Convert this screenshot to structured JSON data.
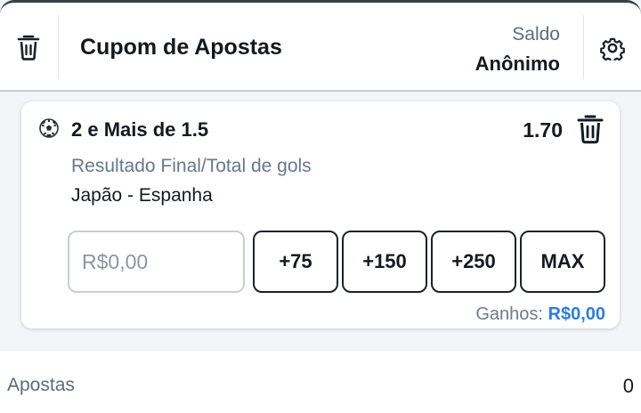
{
  "header": {
    "title": "Cupom de Apostas",
    "saldo_label": "Saldo",
    "saldo_value": "Anônimo",
    "clear_icon": "trash-icon",
    "settings_icon": "gear-icon"
  },
  "bet": {
    "sport_icon": "soccer-ball-icon",
    "selection": "2 e Mais de 1.5",
    "odds": "1.70",
    "market": "Resultado Final/Total de gols",
    "match": "Japão - Espanha",
    "stake_placeholder": "R$0,00",
    "stake_value": "",
    "quick_stakes": [
      "+75",
      "+150",
      "+250",
      "MAX"
    ],
    "winnings_label": "Ganhos:",
    "winnings_value": "R$0,00"
  },
  "summary": {
    "label": "Apostas",
    "count": "0"
  },
  "colors": {
    "accent_blue": "#2d7de0",
    "text_dark": "#141921",
    "text_muted": "#66788f"
  }
}
